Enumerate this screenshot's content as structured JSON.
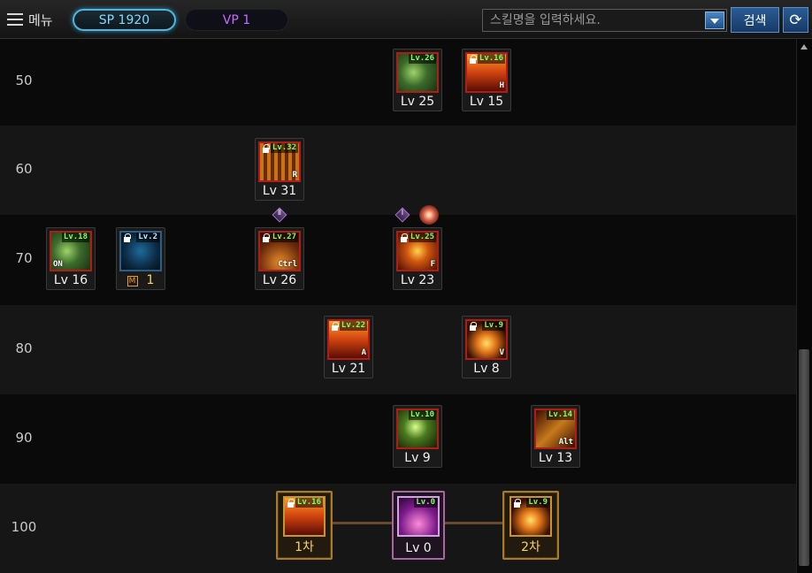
{
  "topbar": {
    "menu_label": "메뉴",
    "sp": "SP 1920",
    "vp": "VP 1",
    "search_placeholder": "스킬명을 입력하세요.",
    "search_button": "검색"
  },
  "rows": [
    {
      "label": "50"
    },
    {
      "label": "60"
    },
    {
      "label": "70"
    },
    {
      "label": "80"
    },
    {
      "label": "90"
    },
    {
      "label": "100"
    }
  ],
  "skills": [
    {
      "id": "s50a",
      "tag": "Lv.26",
      "level": "Lv 25",
      "key": "",
      "locked": false,
      "art": "green"
    },
    {
      "id": "s50b",
      "tag": "Lv.16",
      "level": "Lv 15",
      "key": "H",
      "locked": true,
      "art": "fire"
    },
    {
      "id": "s60a",
      "tag": "Lv.32",
      "level": "Lv 31",
      "key": "R",
      "locked": true,
      "art": "pillars"
    },
    {
      "id": "s70a",
      "tag": "Lv.18",
      "level": "Lv 16",
      "key": "ON",
      "locked": false,
      "art": "green"
    },
    {
      "id": "s70b",
      "tag": "Lv.2",
      "level_mark": "M",
      "level": "1",
      "key": "",
      "locked": true,
      "art": "night"
    },
    {
      "id": "s70c",
      "tag": "Lv.27",
      "level": "Lv 26",
      "key": "Ctrl",
      "locked": true,
      "art": "ground"
    },
    {
      "id": "s70d",
      "tag": "Lv.25",
      "level": "Lv 23",
      "key": "F",
      "locked": true,
      "art": "sun"
    },
    {
      "id": "s80a",
      "tag": "Lv.22",
      "level": "Lv 21",
      "key": "A",
      "locked": true,
      "art": "fire"
    },
    {
      "id": "s80b",
      "tag": "Lv.9",
      "level": "Lv 8",
      "key": "V",
      "locked": true,
      "art": "burst"
    },
    {
      "id": "s90a",
      "tag": "Lv.10",
      "level": "Lv 9",
      "key": "",
      "locked": false,
      "art": "spark"
    },
    {
      "id": "s90b",
      "tag": "Lv.14",
      "level": "Lv 13",
      "key": "Alt",
      "locked": false,
      "art": "yellow"
    },
    {
      "id": "s100a",
      "tag": "Lv.16",
      "level": "1차",
      "key": "",
      "locked": true,
      "art": "fire"
    },
    {
      "id": "s100b",
      "tag": "Lv.0",
      "level": "Lv 0",
      "key": "",
      "locked": false,
      "art": "violet"
    },
    {
      "id": "s100c",
      "tag": "Lv.9",
      "level": "2차",
      "key": "",
      "locked": true,
      "art": "burst"
    }
  ],
  "markers": [
    {
      "text": "Ⅱ"
    },
    {
      "text": "Ⅰ"
    }
  ],
  "icons": {
    "menu": "hamburger-icon",
    "lock": "lock-icon",
    "dropdown": "chevron-down-icon",
    "refresh": "refresh-icon",
    "awakening": "swirl-icon"
  },
  "colors": {
    "sp_accent": "#4fb5dc",
    "vp_text": "#c86bff",
    "level_tag": "#7dff6a",
    "icon_border": "#b01d14",
    "gold_frame": "#a57a2c"
  }
}
